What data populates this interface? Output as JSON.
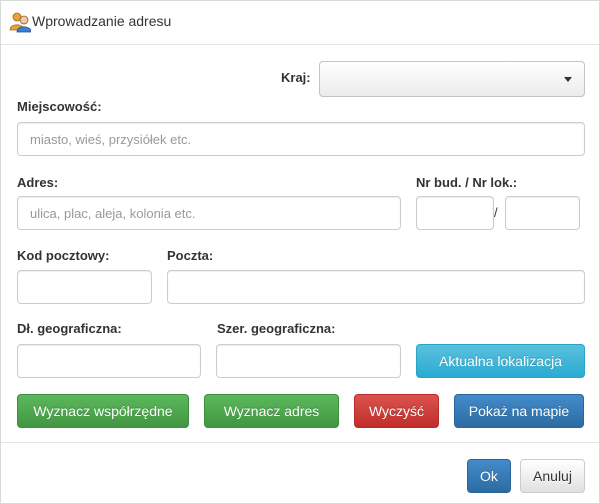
{
  "dialog": {
    "title": "Wprowadzanie adresu",
    "icon": "users-icon"
  },
  "form": {
    "country_label": "Kraj:",
    "country_value": "",
    "city_label": "Miejscowość:",
    "city_placeholder": "miasto, wieś, przysiółek etc.",
    "city_value": "",
    "address_label": "Adres:",
    "address_placeholder": "ulica, plac, aleja, kolonia etc.",
    "address_value": "",
    "building_label": "Nr bud. / Nr lok.:",
    "building_value": "",
    "apartment_value": "",
    "separator": "/",
    "postal_code_label": "Kod pocztowy:",
    "postal_code_value": "",
    "post_office_label": "Poczta:",
    "post_office_value": "",
    "longitude_label": "Dł. geograficzna:",
    "longitude_value": "",
    "latitude_label": "Szer. geograficzna:",
    "latitude_value": ""
  },
  "buttons": {
    "current_location": "Aktualna lokalizacja",
    "find_coordinates": "Wyznacz współrzędne",
    "find_address": "Wyznacz adres",
    "clear": "Wyczyść",
    "show_on_map": "Pokaż na mapie",
    "ok": "Ok",
    "cancel": "Anuluj"
  },
  "colors": {
    "success": "#5cb85c",
    "danger": "#d9534f",
    "primary": "#428bca",
    "info": "#5bc0de"
  }
}
